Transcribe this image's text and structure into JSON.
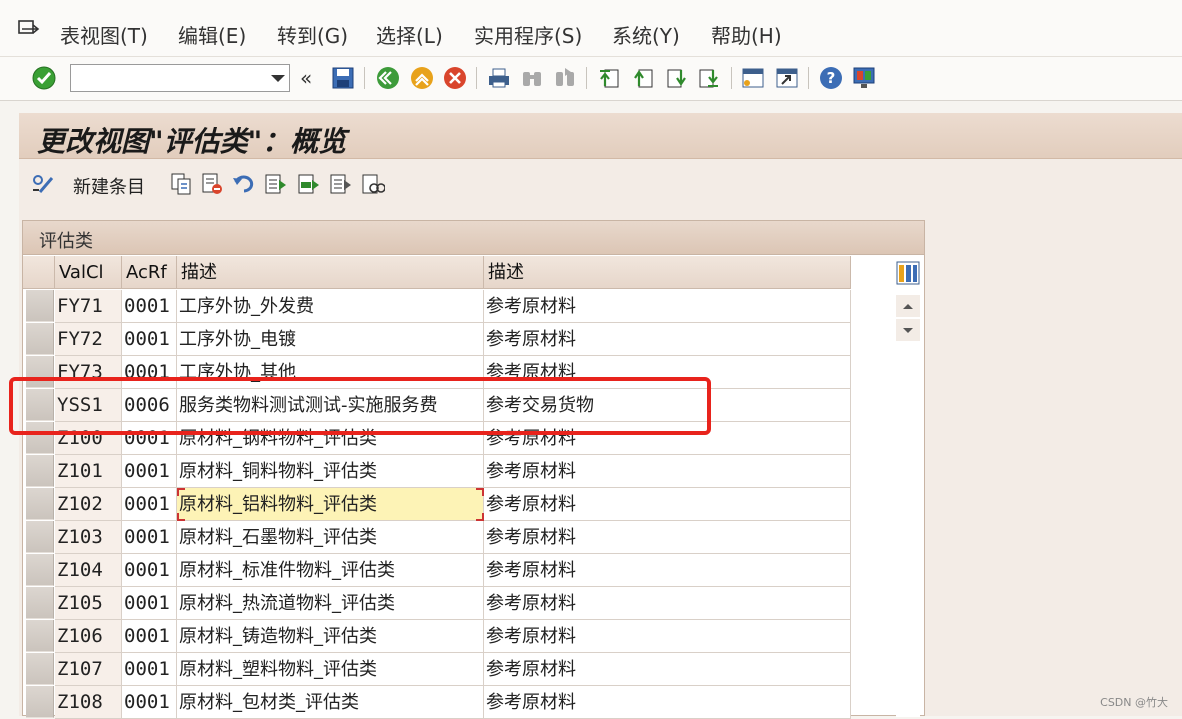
{
  "menubar": {
    "items": [
      "表视图(T)",
      "编辑(E)",
      "转到(G)",
      "选择(L)",
      "实用程序(S)",
      "系统(Y)",
      "帮助(H)"
    ]
  },
  "toolbar": {
    "command_field": "",
    "icons": [
      "enter-check-icon",
      "history-icon",
      "save-icon",
      "back-icon",
      "exit-icon",
      "cancel-icon",
      "print-icon",
      "find-icon",
      "find-next-icon",
      "first-page-icon",
      "prev-page-icon",
      "next-page-icon",
      "last-page-icon",
      "new-session-icon",
      "shortcut-icon",
      "help-icon",
      "layout-icon"
    ]
  },
  "page": {
    "title": "更改视图\"评估类\"：概览",
    "new_entry": "新建条目"
  },
  "table": {
    "caption": "评估类",
    "columns": [
      "ValCl",
      "AcRf",
      "描述",
      "描述"
    ],
    "rows": [
      [
        "FY71",
        "0001",
        "工序外协_外发费",
        "参考原材料"
      ],
      [
        "FY72",
        "0001",
        "工序外协_电镀",
        "参考原材料"
      ],
      [
        "FY73",
        "0001",
        "工序外协_其他",
        "参考原材料"
      ],
      [
        "YSS1",
        "0006",
        "服务类物料测试测试-实施服务费",
        "参考交易货物"
      ],
      [
        "Z100",
        "0001",
        "原材料_钢料物料_评估类",
        "参考原材料"
      ],
      [
        "Z101",
        "0001",
        "原材料_铜料物料_评估类",
        "参考原材料"
      ],
      [
        "Z102",
        "0001",
        "原材料_铝料物料_评估类",
        "参考原材料"
      ],
      [
        "Z103",
        "0001",
        "原材料_石墨物料_评估类",
        "参考原材料"
      ],
      [
        "Z104",
        "0001",
        "原材料_标准件物料_评估类",
        "参考原材料"
      ],
      [
        "Z105",
        "0001",
        "原材料_热流道物料_评估类",
        "参考原材料"
      ],
      [
        "Z106",
        "0001",
        "原材料_铸造物料_评估类",
        "参考原材料"
      ],
      [
        "Z107",
        "0001",
        "原材料_塑料物料_评估类",
        "参考原材料"
      ],
      [
        "Z108",
        "0001",
        "原材料_包材类_评估类",
        "参考原材料"
      ]
    ]
  },
  "watermark": "CSDN @竹大",
  "colors": {
    "highlight": "#e8231c",
    "focus": "#fdf3b6"
  }
}
